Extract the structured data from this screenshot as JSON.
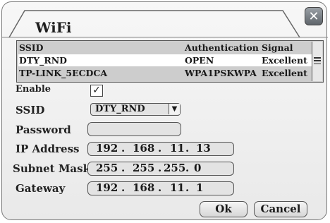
{
  "dialog": {
    "title": "WiFi",
    "close_label": "✕"
  },
  "network_list": {
    "columns": {
      "ssid": "SSID",
      "authentication": "Authentication",
      "signal": "Signal"
    },
    "rows": [
      {
        "ssid": "DTY_RND",
        "authentication": "OPEN",
        "signal": "Excellent",
        "selected": true
      },
      {
        "ssid": "TP-LINK_5ECDCA",
        "authentication": "WPA1PSKWPA",
        "signal": "Excellent",
        "selected": false
      }
    ]
  },
  "form": {
    "enable_label": "Enable",
    "enable_checked": true,
    "enable_mark": "✓",
    "ssid_label": "SSID",
    "ssid_value": "DTY_RND",
    "ssid_arrow": "▼",
    "password_label": "Password",
    "password_value": "",
    "ip_label": "IP Address",
    "ip": [
      "192",
      "168",
      "11",
      "13"
    ],
    "subnet_label": "Subnet Mask",
    "subnet": [
      "255",
      "255",
      "255",
      "0"
    ],
    "gateway_label": "Gateway",
    "gateway": [
      "192",
      "168",
      "11",
      "1"
    ],
    "dot": "."
  },
  "buttons": {
    "ok": "Ok",
    "cancel": "Cancel"
  },
  "colors": {
    "selected_row": "#ffffff",
    "list_bg": "#cdcdcd",
    "dialog_bg": "#eeeeee"
  }
}
